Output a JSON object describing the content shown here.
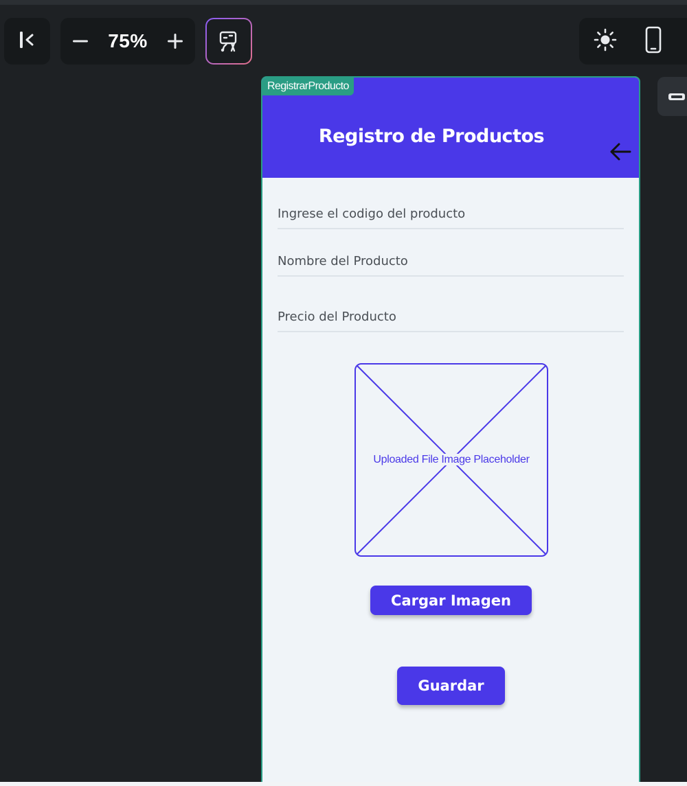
{
  "toolbar": {
    "zoom_value": "75%",
    "collapse_icon": "collapse-panel-icon",
    "zoom_out_icon": "minus-icon",
    "zoom_in_icon": "plus-icon",
    "ai_icon": "ai-sparkle-icon",
    "theme_icon": "sun-icon",
    "device_icon": "phone-icon"
  },
  "frame": {
    "label": "RegistrarProducto"
  },
  "screen": {
    "title": "Registro de Productos",
    "back_icon": "arrow-left-icon",
    "fields": {
      "code_placeholder": "Ingrese el codigo del producto",
      "name_placeholder": "Nombre del Producto",
      "price_placeholder": "Precio del Producto"
    },
    "image_placeholder_text": "Uploaded File Image Placeholder",
    "upload_button": "Cargar Imagen",
    "save_button": "Guardar"
  },
  "colors": {
    "accent": "#4a38e8",
    "frame_border": "#2a9d84",
    "canvas_background": "#1e2124",
    "screen_background": "#f0f4f8"
  }
}
